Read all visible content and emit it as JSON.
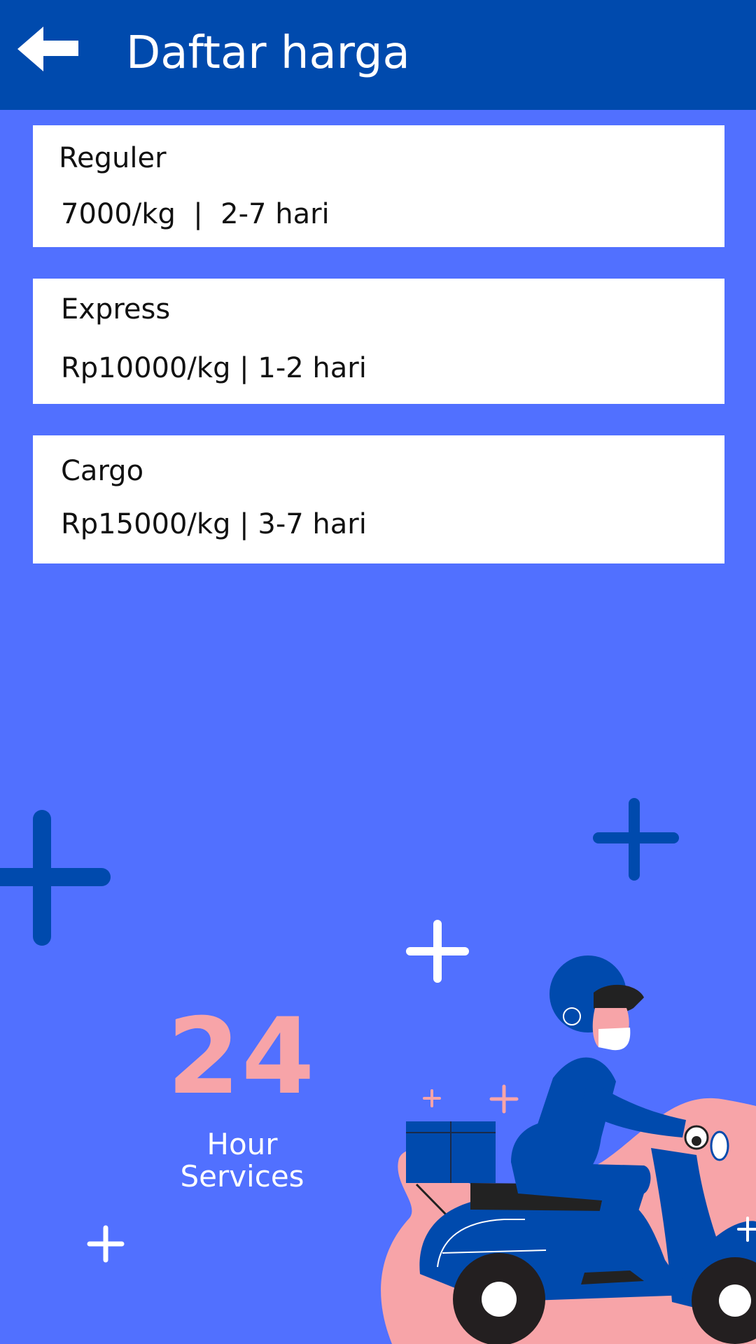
{
  "header": {
    "title": "Daftar harga",
    "back_icon": "arrow-left-icon"
  },
  "price_list": [
    {
      "name": "Reguler",
      "detail": "7000/kg  |  2-7 hari"
    },
    {
      "name": "Express",
      "detail": "Rp10000/kg | 1-2 hari"
    },
    {
      "name": "Cargo",
      "detail": "Rp15000/kg | 3-7 hari"
    }
  ],
  "promo": {
    "number": "24",
    "line1": "Hour",
    "line2": "Services"
  },
  "colors": {
    "header": "#004AAD",
    "background": "#5170FF",
    "card": "#FFFFFF",
    "accent_pink": "#F7A4A8"
  }
}
